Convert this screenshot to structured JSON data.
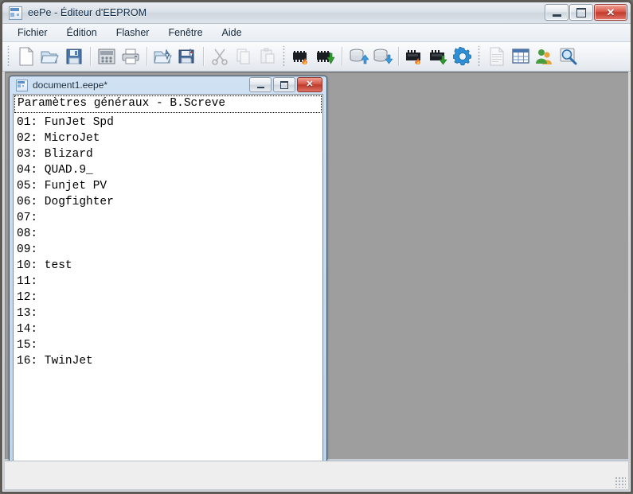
{
  "window": {
    "title": "eePe - Éditeur d'EEPROM",
    "icon": "application-icon",
    "caption": {
      "minimize": "–",
      "maximize": "□",
      "close": "✕"
    }
  },
  "menubar": {
    "items": [
      {
        "label": "Fichier",
        "name": "menu-fichier"
      },
      {
        "label": "Édition",
        "name": "menu-edition"
      },
      {
        "label": "Flasher",
        "name": "menu-flasher"
      },
      {
        "label": "Fenêtre",
        "name": "menu-fenetre"
      },
      {
        "label": "Aide",
        "name": "menu-aide"
      }
    ]
  },
  "toolbar": {
    "groups": [
      {
        "buttons": [
          {
            "icon": "new-document-icon",
            "tooltip": "Nouveau"
          },
          {
            "icon": "open-folder-icon",
            "tooltip": "Ouvrir"
          },
          {
            "icon": "save-floppy-icon",
            "tooltip": "Enregistrer"
          }
        ]
      },
      {
        "buttons": [
          {
            "icon": "simulator-keypad-icon",
            "tooltip": "Simulateur"
          },
          {
            "icon": "print-icon",
            "tooltip": "Imprimer"
          }
        ]
      },
      {
        "buttons": [
          {
            "icon": "open-model-rocket-icon",
            "tooltip": "Ouvrir modèle"
          },
          {
            "icon": "save-model-rocket-icon",
            "tooltip": "Enregistrer modèle"
          }
        ]
      },
      {
        "buttons": [
          {
            "icon": "cut-scissors-icon",
            "tooltip": "Couper",
            "disabled": true
          },
          {
            "icon": "copy-pages-icon",
            "tooltip": "Copier",
            "disabled": true
          },
          {
            "icon": "paste-clipboard-icon",
            "tooltip": "Coller",
            "disabled": true
          }
        ]
      },
      {
        "buttons": [
          {
            "icon": "chip-burn-flame-icon",
            "tooltip": "Écrire EEPROM"
          },
          {
            "icon": "chip-read-arrow-icon",
            "tooltip": "Lire EEPROM"
          }
        ]
      },
      {
        "buttons": [
          {
            "icon": "memory-upload-icon",
            "tooltip": "Envoyer mémoire"
          },
          {
            "icon": "memory-download-icon",
            "tooltip": "Recevoir mémoire"
          }
        ]
      },
      {
        "buttons": [
          {
            "icon": "flash-burn-flame-icon",
            "tooltip": "Flasher firmware"
          },
          {
            "icon": "flash-download-icon",
            "tooltip": "Télécharger firmware"
          },
          {
            "icon": "preferences-gear-icon",
            "tooltip": "Préférences"
          }
        ]
      },
      {
        "buttons": [
          {
            "icon": "text-document-icon",
            "tooltip": "Notes",
            "disabled": true
          },
          {
            "icon": "spreadsheet-grid-icon",
            "tooltip": "Tableau"
          },
          {
            "icon": "contacts-users-icon",
            "tooltip": "Contacts"
          },
          {
            "icon": "search-magnifier-icon",
            "tooltip": "Rechercher"
          }
        ]
      }
    ]
  },
  "mdi_child": {
    "title": "document1.eepe*",
    "icon": "document-icon",
    "caption": {
      "minimize": "–",
      "maximize": "□",
      "close": "✕"
    },
    "header_row": "Paramètres généraux - B.Screve",
    "rows": [
      "01: FunJet Spd",
      "02: MicroJet",
      "03: Blizard",
      "04: QUAD.9_",
      "05: Funjet PV",
      "06: Dogfighter",
      "07:",
      "08:",
      "09:",
      "10: test",
      "11:",
      "12:",
      "13:",
      "14:",
      "15:",
      "16: TwinJet"
    ]
  },
  "statusbar": {
    "text": ""
  },
  "colors": {
    "mdi_background": "#9e9e9e",
    "accent_blue": "#bcd6ee",
    "close_red": "#c23a2b",
    "title_text": "#0b2a47"
  }
}
